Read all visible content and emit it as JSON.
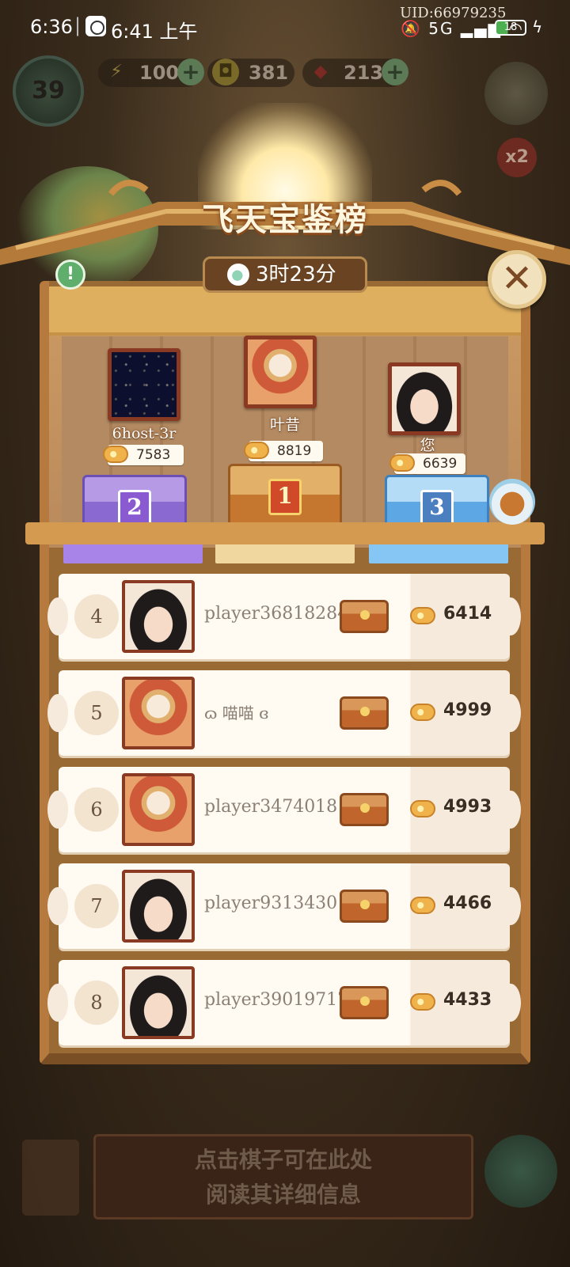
{
  "status_bar": {
    "time": "6:36",
    "separator": "|",
    "time2": "6:41 上午",
    "uid": "UID:66979235",
    "signal": "5G",
    "battery": "18"
  },
  "header": {
    "level": "39",
    "energy": "100",
    "coins": "381",
    "gems": "213",
    "multiplier": "x2"
  },
  "panel": {
    "title": "飞天宝鉴榜",
    "timer": "3时23分"
  },
  "podium": [
    {
      "rank": "2",
      "name": "6host-3r",
      "score": "7583"
    },
    {
      "rank": "1",
      "name": "叶昔",
      "score": "8819"
    },
    {
      "rank": "3",
      "name": "您",
      "score": "6639"
    }
  ],
  "rankings": [
    {
      "rank": "4",
      "name": "player36818284",
      "score": "6414"
    },
    {
      "rank": "5",
      "name": "ɷ 喵喵 ɞ",
      "score": "4999"
    },
    {
      "rank": "6",
      "name": "player3474018",
      "score": "4993"
    },
    {
      "rank": "7",
      "name": "player9313430",
      "score": "4466"
    },
    {
      "rank": "8",
      "name": "player39019717",
      "score": "4433"
    }
  ],
  "hint": {
    "line1": "点击棋子可在此处",
    "line2": "阅读其详细信息"
  },
  "colors": {
    "panel_wood": "#9a6a35",
    "rank_row_bg": "#fffaf2",
    "gold_chest": "#c5762f",
    "purple_chest": "#8a6ad1",
    "blue_chest": "#5da7e4"
  },
  "icons": [
    "clock-icon",
    "energy-icon",
    "coin-icon",
    "gem-icon",
    "plus-icon",
    "info-icon",
    "close-icon",
    "timer-icon",
    "cloud-score-icon",
    "chest-icon"
  ]
}
